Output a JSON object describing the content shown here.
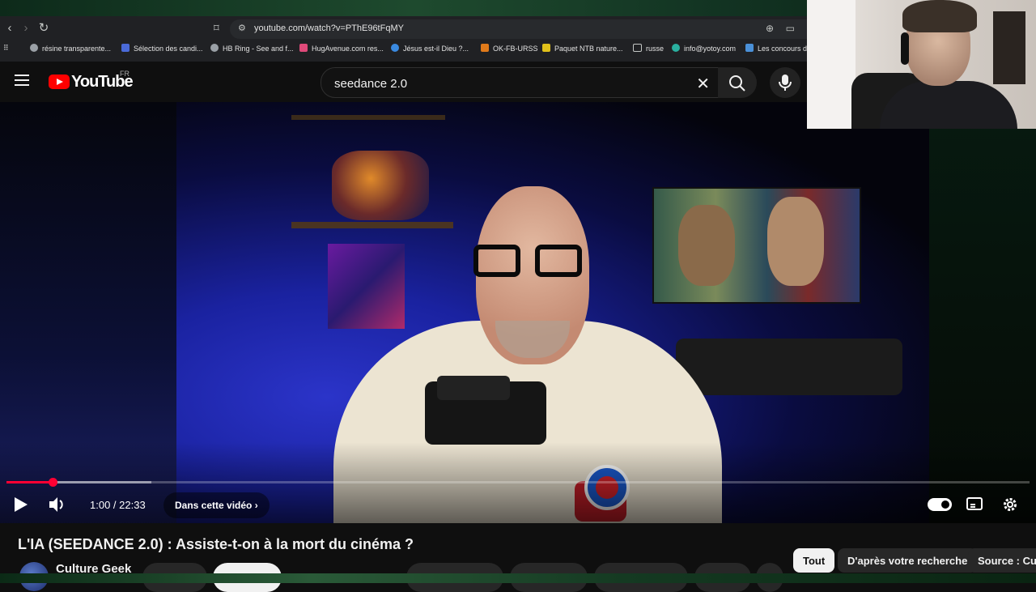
{
  "browser": {
    "url": "youtube.com/watch?v=PThE96tFqMY",
    "bookmarks": [
      {
        "label": "résine transparente...",
        "color": "#9aa0a6"
      },
      {
        "label": "Sélection des candi...",
        "color": "#4a6ad8"
      },
      {
        "label": "HB Ring - See and f...",
        "color": "#9aa0a6"
      },
      {
        "label": "HugAvenue.com res...",
        "color": "#e04a7a"
      },
      {
        "label": "Jésus est-il Dieu ?...",
        "color": "#3a8ae0"
      },
      {
        "label": "OK-FB-URSS",
        "color": "#e07a1a"
      },
      {
        "label": "Paquet NTB nature...",
        "color": "#e0c01a"
      },
      {
        "label": "russe",
        "color": "#9aa0a6"
      },
      {
        "label": "info@yotoy.com",
        "color": "#2ab0a0"
      },
      {
        "label": "Les concours d'",
        "color": "#4a90d8"
      }
    ]
  },
  "youtube": {
    "logo_text": "YouTube",
    "region": "FR",
    "search_query": "seedance 2.0"
  },
  "player": {
    "time": "1:00 / 22:33",
    "progress_fraction": 0.0448,
    "buffer_fraction": 0.142,
    "chapter_label": "Dans cette vidéo",
    "chapter_icon": "chevron-right-icon"
  },
  "video": {
    "title": "L'IA (SEEDANCE 2.0) : Assiste-t-on à la mort du cinéma ?",
    "channel": "Culture Geek"
  },
  "chips": [
    "Tout",
    "D'après votre recherche",
    "Source : Cult"
  ],
  "colors": {
    "accent": "#ff0000",
    "progress": "#ff0033",
    "background": "#0f0f0f"
  }
}
